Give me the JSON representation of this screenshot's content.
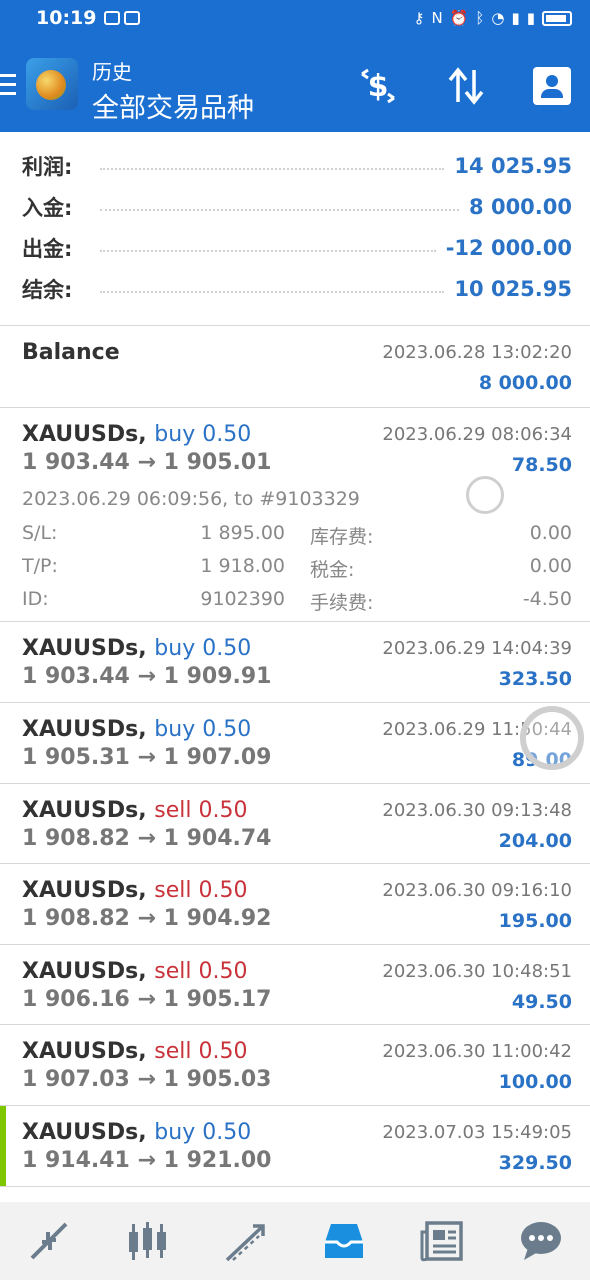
{
  "status_bar": {
    "time": "10:19"
  },
  "header": {
    "title_small": "历史",
    "title_big": "全部交易品种",
    "icons": [
      "dollar-sync-icon",
      "sort-icon",
      "account-icon"
    ]
  },
  "summary": [
    {
      "label": "利润:",
      "value": "14 025.95"
    },
    {
      "label": "入金:",
      "value": "8 000.00"
    },
    {
      "label": "出金:",
      "value": "-12 000.00"
    },
    {
      "label": "结余:",
      "value": "10 025.95"
    }
  ],
  "balance": {
    "title": "Balance",
    "time": "2023.06.28 13:02:20",
    "amount": "8 000.00"
  },
  "expanded_deal": {
    "symbol": "XAUUSDs,",
    "side": "buy 0.50",
    "prices": "1 903.44 → 1 905.01",
    "time": "2023.06.29 08:06:34",
    "profit": "78.50",
    "open_info": "2023.06.29 06:09:56, to #9103329",
    "sl_label": "S/L:",
    "sl_value": "1 895.00",
    "tp_label": "T/P:",
    "tp_value": "1 918.00",
    "id_label": "ID:",
    "id_value": "9102390",
    "swap_label": "库存费:",
    "swap_value": "0.00",
    "tax_label": "税金:",
    "tax_value": "0.00",
    "fee_label": "手续费:",
    "fee_value": "-4.50"
  },
  "deals": [
    {
      "symbol": "XAUUSDs,",
      "side": "buy 0.50",
      "type": "buy",
      "prices": "1 903.44 → 1 909.91",
      "time": "2023.06.29 14:04:39",
      "profit": "323.50"
    },
    {
      "symbol": "XAUUSDs,",
      "side": "buy 0.50",
      "type": "buy",
      "prices": "1 905.31 → 1 907.09",
      "time": "2023.06.29 11:50:44",
      "profit": "89.00"
    },
    {
      "symbol": "XAUUSDs,",
      "side": "sell 0.50",
      "type": "sell",
      "prices": "1 908.82 → 1 904.74",
      "time": "2023.06.30 09:13:48",
      "profit": "204.00"
    },
    {
      "symbol": "XAUUSDs,",
      "side": "sell 0.50",
      "type": "sell",
      "prices": "1 908.82 → 1 904.92",
      "time": "2023.06.30 09:16:10",
      "profit": "195.00"
    },
    {
      "symbol": "XAUUSDs,",
      "side": "sell 0.50",
      "type": "sell",
      "prices": "1 906.16 → 1 905.17",
      "time": "2023.06.30 10:48:51",
      "profit": "49.50"
    },
    {
      "symbol": "XAUUSDs,",
      "side": "sell 0.50",
      "type": "sell",
      "prices": "1 907.03 → 1 905.03",
      "time": "2023.06.30 11:00:42",
      "profit": "100.00"
    },
    {
      "symbol": "XAUUSDs,",
      "side": "buy 0.50",
      "type": "buy",
      "prices": "1 914.41 → 1 921.00",
      "time": "2023.07.03 15:49:05",
      "profit": "329.50"
    }
  ],
  "bottom_nav": [
    "quotes-icon",
    "chart-icon",
    "trade-icon",
    "history-icon",
    "news-icon",
    "messages-icon"
  ],
  "colors": {
    "primary": "#1a6fd1",
    "buy": "#2a72c6",
    "sell": "#c8323a",
    "accent_bar": "#7dc600"
  }
}
